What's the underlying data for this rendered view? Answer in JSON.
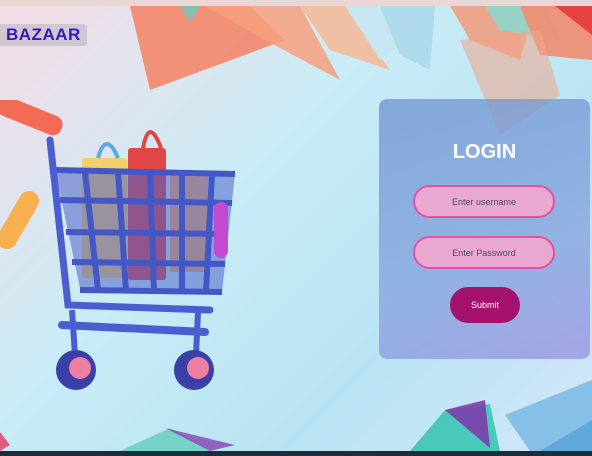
{
  "brand": {
    "name": "BAZAAR"
  },
  "login": {
    "title": "LOGIN",
    "username_placeholder": "Enter username",
    "password_placeholder": "Enter Password",
    "submit_label": "Submit"
  },
  "icons": [
    "shopping-cart-icon"
  ],
  "colors": {
    "brand_text": "#3a16b8",
    "panel": "#7f9fd8",
    "field_fill": "#e9a8cf",
    "field_border": "#e64fa6",
    "submit": "#a4126e"
  }
}
